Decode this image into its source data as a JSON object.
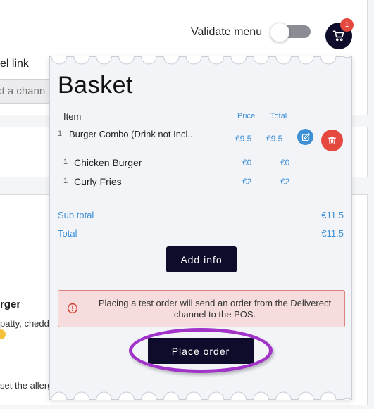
{
  "header": {
    "validate_menu_label": "Validate menu",
    "validate_menu_on": false,
    "cart_count": "1"
  },
  "background": {
    "channel_link_label": "el link",
    "channel_select_placeholder": "ct a chann",
    "product_title": "rger",
    "product_desc": "patty, chedda",
    "allergen_text": "set the allerg"
  },
  "basket": {
    "title": "Basket",
    "columns": {
      "item": "Item",
      "price": "Price",
      "total": "Total"
    },
    "items": [
      {
        "qty": "1",
        "name": "Burger Combo (Drink not Incl...",
        "price": "€9.5",
        "total": "€9.5"
      },
      {
        "qty": "1",
        "name": "Chicken Burger",
        "price": "€0",
        "total": "€0"
      },
      {
        "qty": "1",
        "name": "Curly Fries",
        "price": "€2",
        "total": "€2"
      }
    ],
    "subtotal_label": "Sub total",
    "subtotal_value": "€11.5",
    "total_label": "Total",
    "total_value": "€11.5",
    "add_info_label": "Add info",
    "alert_text": "Placing a test order will send an order from the Deliverect channel to the POS.",
    "place_order_label": "Place order"
  },
  "colors": {
    "primary": "#0d0d2b",
    "accent": "#3d8fd6",
    "danger": "#e5483f",
    "highlight": "#a233c9"
  }
}
